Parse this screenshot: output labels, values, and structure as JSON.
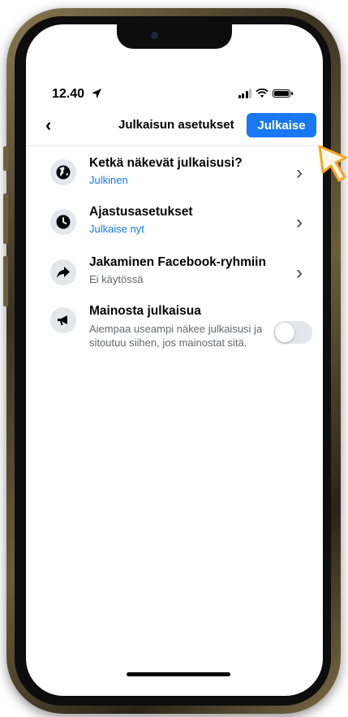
{
  "status_bar": {
    "time": "12.40"
  },
  "header": {
    "title": "Julkaisun asetukset",
    "publish_label": "Julkaise"
  },
  "settings": [
    {
      "title": "Ketkä näkevät julkaisusi?",
      "value": "Julkinen"
    },
    {
      "title": "Ajastusasetukset",
      "value": "Julkaise nyt"
    },
    {
      "title": "Jakaminen Facebook-ryhmiin",
      "value": "Ei käytössä"
    }
  ],
  "promote": {
    "title": "Mainosta julkaisua",
    "description": "Aiempaa useampi näkee julkaisusi ja sitoutuu siihen, jos mainostat sitä.",
    "enabled": false
  },
  "colors": {
    "accent": "#1877f2",
    "frame": "#6b5c3a",
    "cursor": "#f5a623"
  },
  "icons": [
    "location-arrow-icon",
    "signal-icon",
    "wifi-icon",
    "battery-icon",
    "back-chevron-icon",
    "globe-icon",
    "clock-icon",
    "share-arrow-icon",
    "megaphone-icon",
    "chevron-right-icon",
    "pointer-cursor-icon"
  ]
}
